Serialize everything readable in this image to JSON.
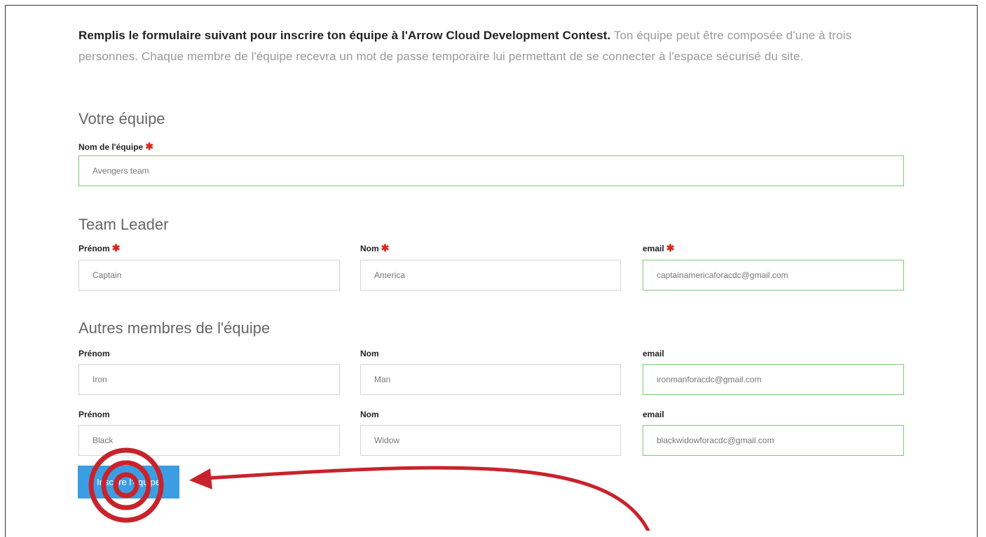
{
  "intro": {
    "bold": "Remplis le formulaire suivant pour inscrire ton équipe à l'Arrow Cloud Development Contest.",
    "rest": " Ton équipe peut être composée d'une à trois personnes. Chaque membre de l'équipe recevra un mot de passe temporaire lui permettant de se connecter à l'espace sécurisé du site."
  },
  "team_section": {
    "title": "Votre équipe",
    "name_label": "Nom de l'équipe",
    "name_value": "Avengers team"
  },
  "leader_section": {
    "title": "Team Leader",
    "firstname_label": "Prénom",
    "lastname_label": "Nom",
    "email_label": "email",
    "firstname_value": "Captain",
    "lastname_value": "America",
    "email_value": "captainamericaforacdc@gmail.com"
  },
  "members_section": {
    "title": "Autres membres de l'équipe",
    "members": [
      {
        "firstname_label": "Prénom",
        "lastname_label": "Nom",
        "email_label": "email",
        "firstname_value": "Iron",
        "lastname_value": "Man",
        "email_value": "ironmanforacdc@gmail.com"
      },
      {
        "firstname_label": "Prénom",
        "lastname_label": "Nom",
        "email_label": "email",
        "firstname_value": "Black",
        "lastname_value": "Widow",
        "email_value": "blackwidowforacdc@gmail.com"
      }
    ]
  },
  "required_marker": "✱",
  "submit": {
    "label": "Inscrire l'équipe"
  },
  "colors": {
    "submit_button": "#3b9ee3",
    "valid_border": "#7fc77a",
    "required": "#d9261c",
    "annotation": "#c8232c"
  }
}
